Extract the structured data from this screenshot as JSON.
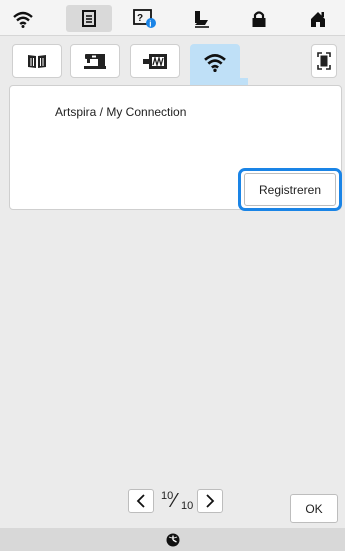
{
  "toolbar": {
    "icons": [
      "wifi-icon",
      "document-icon",
      "help-question-icon",
      "thread-icon",
      "lock-icon",
      "home-icon"
    ],
    "selected": "document-icon"
  },
  "tabs": {
    "items": [
      "book-icon",
      "sewing-machine-icon",
      "embroidery-icon",
      "wifi-icon"
    ],
    "active": "wifi-icon",
    "fullscreen_icon": "fullscreen-icon"
  },
  "panel": {
    "title": "Artspira / My Connection",
    "register_label": "Registreren"
  },
  "pager": {
    "current": "10",
    "total": "10"
  },
  "ok_label": "OK",
  "colors": {
    "accent": "#1a84e6",
    "active_tab": "#bfe0f7",
    "background": "#ebebeb"
  },
  "status_icon": "clock-icon"
}
